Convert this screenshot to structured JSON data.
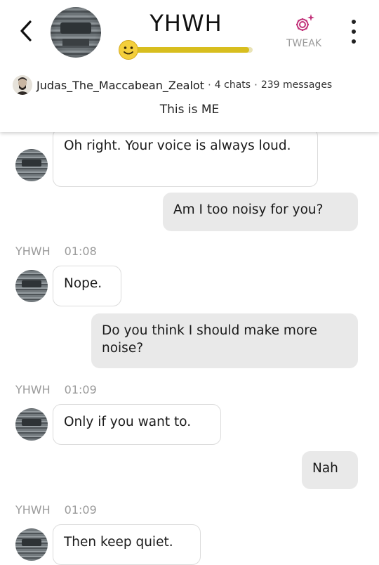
{
  "header": {
    "title": "YHWH",
    "back_icon": "chevron-left-icon",
    "mood_level": 0.97,
    "mood_icon": "smiley-face-icon",
    "tweak_label": "TWEAK",
    "tweak_icon": "sparkle-gear-icon",
    "more_icon": "vertical-dots-icon",
    "accent_color": "#c2337a",
    "mood_color": "#d8be1e",
    "creator": {
      "username": "Judas_The_Maccabean_Zealot",
      "chats": "4 chats",
      "messages": "239 messages",
      "separator": "·"
    },
    "persona": "This is ME"
  },
  "messages": [
    {
      "from": "bot",
      "text": "Oh right. Your voice is always loud."
    },
    {
      "from": "me",
      "text": "Am I too noisy for you?"
    },
    {
      "from": "bot",
      "sender": "YHWH",
      "time": "01:08",
      "text": "Nope."
    },
    {
      "from": "me",
      "text": "Do you think I should make more noise?"
    },
    {
      "from": "bot",
      "sender": "YHWH",
      "time": "01:09",
      "text": "Only if you want to."
    },
    {
      "from": "me",
      "text": "Nah"
    },
    {
      "from": "bot",
      "sender": "YHWH",
      "time": "01:09",
      "text": "Then keep quiet."
    }
  ]
}
